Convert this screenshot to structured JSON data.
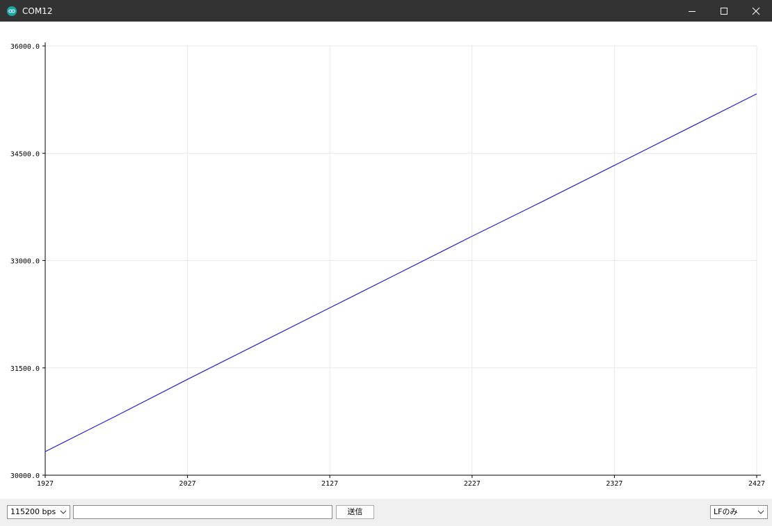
{
  "window": {
    "title": "COM12"
  },
  "toolbar": {
    "baud_rate": "115200 bps",
    "send_value": "",
    "send_label": "送信",
    "line_ending": "LFのみ"
  },
  "colors": {
    "titlebar": "#333333",
    "series": "#1f1fcf",
    "grid": "#e9e9e9",
    "bottombar": "#f0f0f0"
  },
  "chart_data": {
    "type": "line",
    "title": "",
    "xlabel": "",
    "ylabel": "",
    "xlim": [
      1927,
      2427
    ],
    "ylim": [
      30000,
      36000
    ],
    "grid": true,
    "x_ticks": [
      "1927",
      "2027",
      "2127",
      "2227",
      "2327",
      "2427"
    ],
    "y_ticks": [
      "30000.0",
      "31500.0",
      "33000.0",
      "34500.0",
      "36000.0"
    ],
    "series": [
      {
        "name": "",
        "color": "#1f1fcf",
        "x": [
          1927,
          1977,
          2027,
          2077,
          2127,
          2177,
          2227,
          2277,
          2327,
          2377,
          2427
        ],
        "values": [
          30330,
          30830,
          31340,
          31840,
          32340,
          32840,
          33340,
          33830,
          34330,
          34830,
          35330
        ]
      }
    ]
  }
}
